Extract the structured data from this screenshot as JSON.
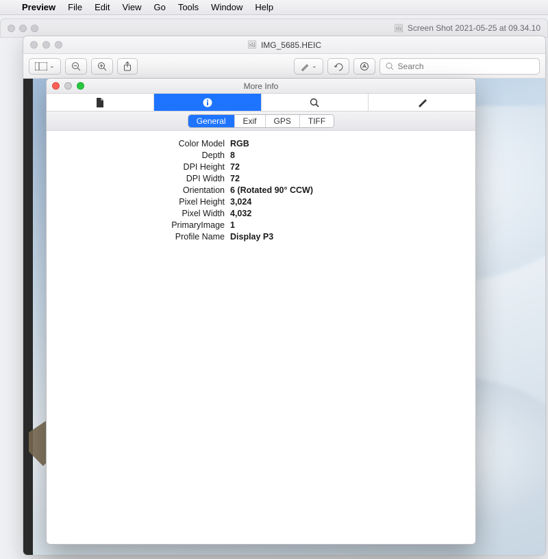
{
  "menubar": {
    "app": "Preview",
    "items": [
      "File",
      "Edit",
      "View",
      "Go",
      "Tools",
      "Window",
      "Help"
    ]
  },
  "background_window": {
    "title": "Screen Shot 2021-05-25 at 09.34.10"
  },
  "document_window": {
    "title": "IMG_5685.HEIC",
    "search_placeholder": "Search"
  },
  "inspector": {
    "title": "More Info",
    "icon_tabs": [
      "document-icon",
      "info-icon",
      "search-icon",
      "edit-icon"
    ],
    "sub_tabs": [
      "General",
      "Exif",
      "GPS",
      "TIFF"
    ],
    "selected_sub_tab": "General",
    "properties": [
      {
        "label": "Color Model",
        "value": "RGB"
      },
      {
        "label": "Depth",
        "value": "8"
      },
      {
        "label": "DPI Height",
        "value": "72"
      },
      {
        "label": "DPI Width",
        "value": "72"
      },
      {
        "label": "Orientation",
        "value": "6 (Rotated 90° CCW)"
      },
      {
        "label": "Pixel Height",
        "value": "3,024"
      },
      {
        "label": "Pixel Width",
        "value": "4,032"
      },
      {
        "label": "PrimaryImage",
        "value": "1"
      },
      {
        "label": "Profile Name",
        "value": "Display P3"
      }
    ]
  }
}
